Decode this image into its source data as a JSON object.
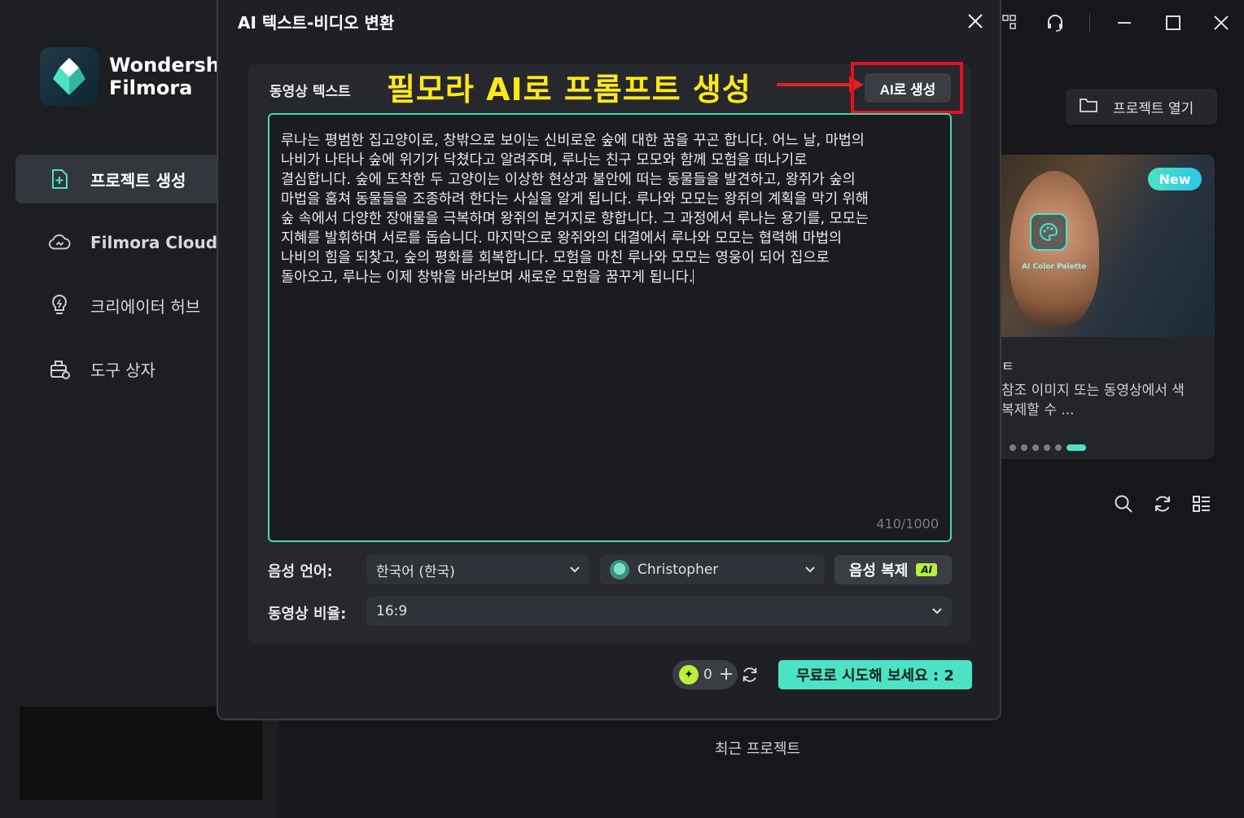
{
  "app": {
    "brand_line1": "Wondershare",
    "brand_line2": "Filmora"
  },
  "sidebar": {
    "items": [
      {
        "label": "프로젝트 생성",
        "icon": "plus-square-icon",
        "active": true
      },
      {
        "label": "Filmora Cloud",
        "icon": "cloud-icon",
        "active": false
      },
      {
        "label": "크리에이터 허브",
        "icon": "lightbulb-icon",
        "active": false
      },
      {
        "label": "도구 상자",
        "icon": "toolbox-icon",
        "active": false
      }
    ]
  },
  "header": {
    "open_project": "프로젝트 열기"
  },
  "promo": {
    "badge": "New",
    "lens_label": "AI Color Palette",
    "title": "ㅌ",
    "desc": "참조 이미지 또는 동영상에서 색\n복제할 수 ..."
  },
  "recent": {
    "label": "최근 프로젝트"
  },
  "modal": {
    "title": "AI 텍스트-비디오 변환",
    "text_label": "동영상 텍스트",
    "annotation": "필모라 AI로 프롬프트 생성",
    "ai_generate": "AI로 생성",
    "body_text": "루나는 평범한 집고양이로, 창밖으로 보이는 신비로운 숲에 대한 꿈을 꾸곤 합니다. 어느 날, 마법의\n나비가 나타나 숲에 위기가 닥쳤다고 알려주며, 루나는 친구 모모와 함께 모험을 떠나기로\n결심합니다. 숲에 도착한 두 고양이는 이상한 현상과 불안에 떠는 동물들을 발견하고, 왕쥐가 숲의\n마법을 훔쳐 동물들을 조종하려 한다는 사실을 알게 됩니다. 루나와 모모는 왕쥐의 계획을 막기 위해\n숲 속에서 다양한 장애물을 극복하며 왕쥐의 본거지로 향합니다. 그 과정에서 루나는 용기를, 모모는\n지혜를 발휘하며 서로를 돕습니다. 마지막으로 왕쥐와의 대결에서 루나와 모모는 협력해 마법의\n나비의 힘을 되찾고, 숲의 평화를 회복합니다. 모험을 마친 루나와 모모는 영웅이 되어 집으로\n돌아오고, 루나는 이제 창밖을 바라보며 새로운 모험을 꿈꾸게 됩니다.",
    "char_count": "410/1000",
    "voice_lang_label": "음성 언어:",
    "voice_lang_value": "한국어 (한국)",
    "voice_name": "Christopher",
    "voice_clone": "음성 복제",
    "ai_tag": "AI",
    "ratio_label": "동영상 비율:",
    "ratio_value": "16:9",
    "credits": "0",
    "try_free": "무료로 시도해 보세요 : 2"
  },
  "colors": {
    "accent": "#4ce3c4",
    "annotation": "#ffe81a",
    "highlight_box": "#e3121e"
  }
}
